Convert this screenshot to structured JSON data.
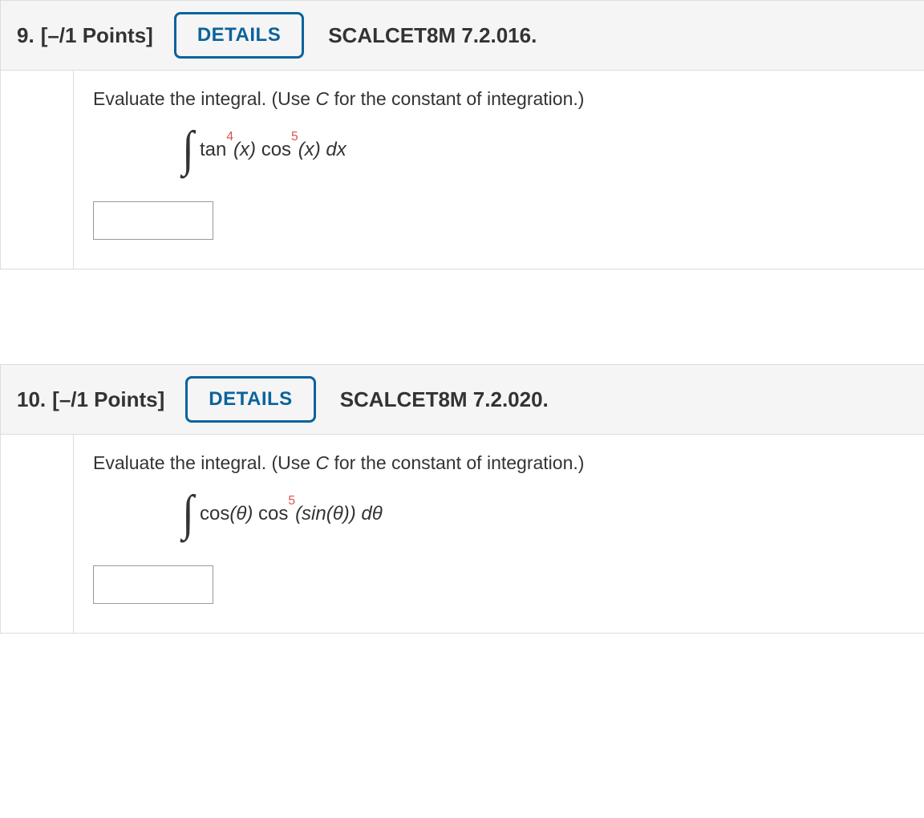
{
  "questions": [
    {
      "number": "9.",
      "points": "[–/1 Points]",
      "details_label": "DETAILS",
      "code": "SCALCET8M 7.2.016.",
      "prompt_pre": "Evaluate the integral. (Use ",
      "prompt_var": "C",
      "prompt_post": " for the constant of integration.)",
      "math": {
        "a_fn": "tan",
        "a_pow": "4",
        "a_arg": "(x)",
        "b_fn": " cos",
        "b_pow": "5",
        "b_arg": "(x) ",
        "diff": "dx"
      }
    },
    {
      "number": "10.",
      "points": "[–/1 Points]",
      "details_label": "DETAILS",
      "code": "SCALCET8M 7.2.020.",
      "prompt_pre": "Evaluate the integral. (Use ",
      "prompt_var": "C",
      "prompt_post": " for the constant of integration.)",
      "math": {
        "a_fn": "cos",
        "a_pow": "",
        "a_arg": "(θ)",
        "b_fn": " cos",
        "b_pow": "5",
        "b_arg": "(sin(θ)) ",
        "diff": "dθ"
      }
    }
  ]
}
